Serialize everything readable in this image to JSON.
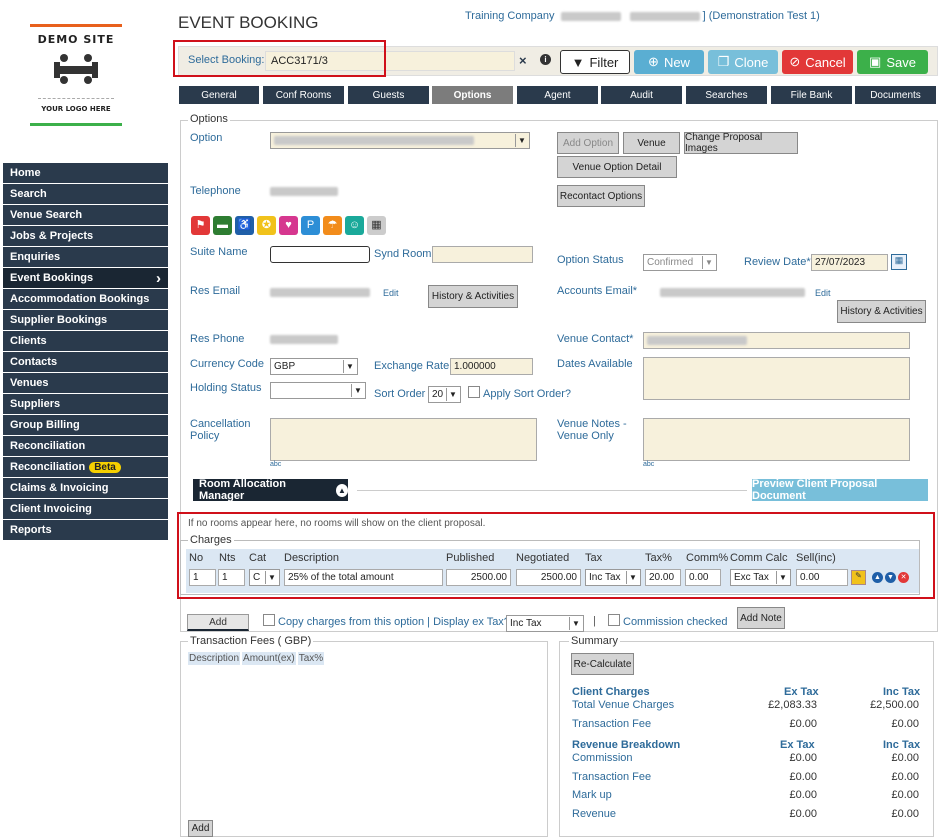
{
  "logo": {
    "title": "DEMO SITE",
    "subtitle": "YOUR LOGO HERE"
  },
  "sidebar": {
    "items": [
      {
        "label": "Home"
      },
      {
        "label": "Search"
      },
      {
        "label": "Venue Search"
      },
      {
        "label": "Jobs & Projects"
      },
      {
        "label": "Enquiries"
      },
      {
        "label": "Event Bookings"
      },
      {
        "label": "Accommodation Bookings"
      },
      {
        "label": "Supplier Bookings"
      },
      {
        "label": "Clients"
      },
      {
        "label": "Contacts"
      },
      {
        "label": "Venues"
      },
      {
        "label": "Suppliers"
      },
      {
        "label": "Group Billing"
      },
      {
        "label": "Reconciliation"
      },
      {
        "label": "Reconciliation",
        "badge": "Beta"
      },
      {
        "label": "Claims & Invoicing"
      },
      {
        "label": "Client Invoicing"
      },
      {
        "label": "Reports"
      }
    ],
    "active_label": "Event Bookings"
  },
  "header": {
    "title": "EVENT BOOKING",
    "company_prefix": "Training Company",
    "company_suffix": "] (Demonstration Test 1)"
  },
  "booking": {
    "select_label": "Select Booking:",
    "value": "ACC3171/3",
    "clear": "×",
    "info": "i",
    "filter": "Filter",
    "new": "New",
    "clone": "Clone",
    "cancel": "Cancel",
    "save": "Save"
  },
  "tabs": [
    "General",
    "Conf Rooms",
    "Guests",
    "Options",
    "Agent",
    "Audit",
    "Searches",
    "File Bank",
    "Documents"
  ],
  "options": {
    "legend": "Options",
    "option_label": "Option",
    "add_option": "Add Option",
    "venue": "Venue",
    "change_images": "Change Proposal Images",
    "venue_option_detail": "Venue Option Detail",
    "recontact": "Recontact Options",
    "telephone_label": "Telephone",
    "suite_label": "Suite Name",
    "synd_label": "Synd Room",
    "option_status_label": "Option Status",
    "option_status_value": "Confirmed",
    "review_date_label": "Review Date*",
    "review_date_value": "27/07/2023",
    "res_email_label": "Res Email",
    "edit1": "Edit",
    "history1": "History & Activities",
    "accounts_email_label": "Accounts Email*",
    "edit2": "Edit",
    "history2": "History & Activities",
    "res_phone_label": "Res Phone",
    "venue_contact_label": "Venue Contact*",
    "currency_label": "Currency Code",
    "currency_value": "GBP",
    "exchange_label": "Exchange Rate",
    "exchange_value": "1.000000",
    "dates_label": "Dates Available",
    "holding_label": "Holding Status",
    "sort_label": "Sort Order",
    "sort_value": "20",
    "apply_sort": "Apply Sort Order?",
    "cancel_label_1": "Cancellation",
    "cancel_label_2": "Policy",
    "notes_label_1": "Venue Notes -",
    "notes_label_2": "Venue Only",
    "abc": "abc",
    "ram": "Room Allocation Manager",
    "preview": "Preview Client Proposal Document",
    "info_text": "If no rooms appear here, no rooms will show on the client proposal."
  },
  "charges": {
    "legend": "Charges",
    "headers": [
      "No",
      "Nts",
      "Cat",
      "Description",
      "Published",
      "Negotiated",
      "Tax",
      "Tax%",
      "Comm%",
      "Comm Calc",
      "Sell(inc)"
    ],
    "row": {
      "no": "1",
      "nts": "1",
      "cat": "C",
      "description": "25% of the total amount",
      "published": "2500.00",
      "negotiated": "2500.00",
      "tax": "Inc Tax",
      "tax_pct": "20.00",
      "comm_pct": "0.00",
      "comm_calc": "Exc Tax",
      "sell": "0.00"
    },
    "add": "Add",
    "copy_label": "Copy charges from this option | Display ex Tax?",
    "display_value": "Inc Tax",
    "pipe": "|",
    "commission_checked": "Commission checked",
    "add_note": "Add Note"
  },
  "fees": {
    "legend": "Transaction Fees ( GBP)",
    "headers": [
      "Description",
      "Amount(ex)",
      "Tax%"
    ],
    "add": "Add"
  },
  "summary": {
    "legend": "Summary",
    "recalc": "Re-Calculate",
    "client_charges": "Client Charges",
    "ex_tax": "Ex Tax",
    "inc_tax": "Inc Tax",
    "rows1": [
      {
        "label": "Total Venue Charges",
        "ex": "£2,083.33",
        "inc": "£2,500.00"
      },
      {
        "label": "Transaction Fee",
        "ex": "£0.00",
        "inc": "£0.00"
      }
    ],
    "revenue_breakdown": "Revenue Breakdown",
    "rows2": [
      {
        "label": "Commission",
        "ex": "£0.00",
        "inc": "£0.00"
      },
      {
        "label": "Transaction Fee",
        "ex": "£0.00",
        "inc": "£0.00"
      },
      {
        "label": "Mark up",
        "ex": "£0.00",
        "inc": "£0.00"
      },
      {
        "label": "Revenue",
        "ex": "£0.00",
        "inc": "£0.00"
      }
    ]
  },
  "colors": {
    "nav": "#2a3a4c",
    "filter": "#ffffff",
    "new": "#5aaed2",
    "clone": "#78bfda",
    "cancel": "#e23838",
    "save": "#3cb04a",
    "highlight": "#d0101a"
  }
}
